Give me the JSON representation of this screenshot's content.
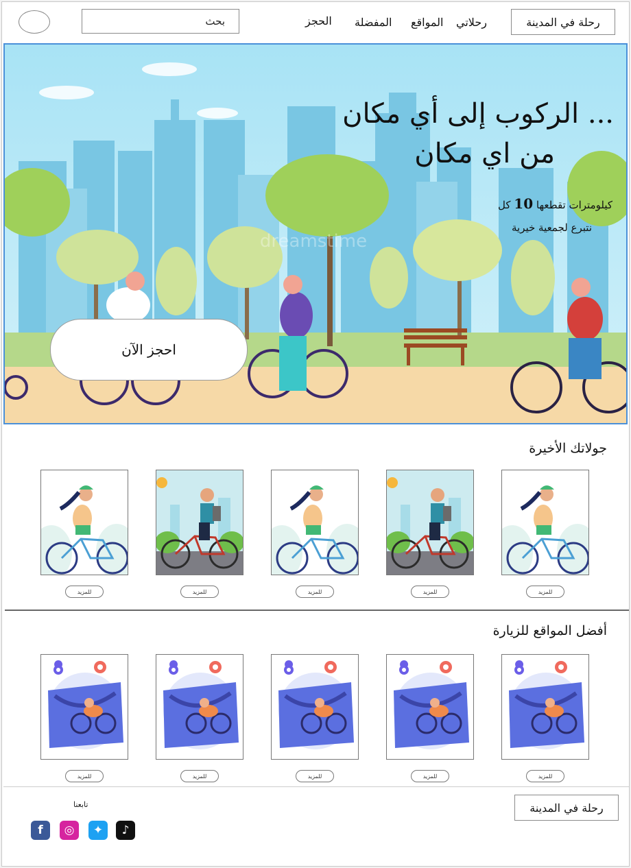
{
  "header": {
    "brand": "رحلة في المدينة",
    "search_text": "بحث",
    "nav": [
      "رحلاتي",
      "المواقع",
      "المفضلة",
      "الحجز"
    ]
  },
  "hero": {
    "title_line1": "الركوب إلى أي مكان ...",
    "title_line2": "من اي مكان",
    "desc_prefix": "كل",
    "desc_number": "10",
    "desc_suffix": "كيلومترات تقطعها",
    "desc_line2": "نتبرع لجمعية خيرية",
    "watermark": "dreamstime",
    "book_button": "احجز الآن"
  },
  "recent_tours": {
    "title": "جولاتك الأخيرة",
    "items": [
      {
        "image": "cyclist-woman",
        "button": "للمزيد"
      },
      {
        "image": "cyclist-man",
        "button": "للمزيد"
      },
      {
        "image": "cyclist-woman",
        "button": "للمزيد"
      },
      {
        "image": "cyclist-man",
        "button": "للمزيد"
      },
      {
        "image": "cyclist-woman",
        "button": "للمزيد"
      }
    ]
  },
  "best_places": {
    "title": "أفضل المواقع للزيارة",
    "items": [
      {
        "image": "map-cyclist",
        "button": "للمزيد"
      },
      {
        "image": "map-cyclist",
        "button": "للمزيد"
      },
      {
        "image": "map-cyclist",
        "button": "للمزيد"
      },
      {
        "image": "map-cyclist",
        "button": "للمزيد"
      },
      {
        "image": "map-cyclist",
        "button": "للمزيد"
      }
    ]
  },
  "footer": {
    "brand": "رحلة في المدينة",
    "follow_label": "تابعنا",
    "social": [
      {
        "icon": "tiktok-icon",
        "color": "#111111"
      },
      {
        "icon": "twitter-icon",
        "color": "#1da1f2"
      },
      {
        "icon": "instagram-icon",
        "color": "#d6249f"
      },
      {
        "icon": "facebook-icon",
        "color": "#3b5998"
      }
    ]
  }
}
